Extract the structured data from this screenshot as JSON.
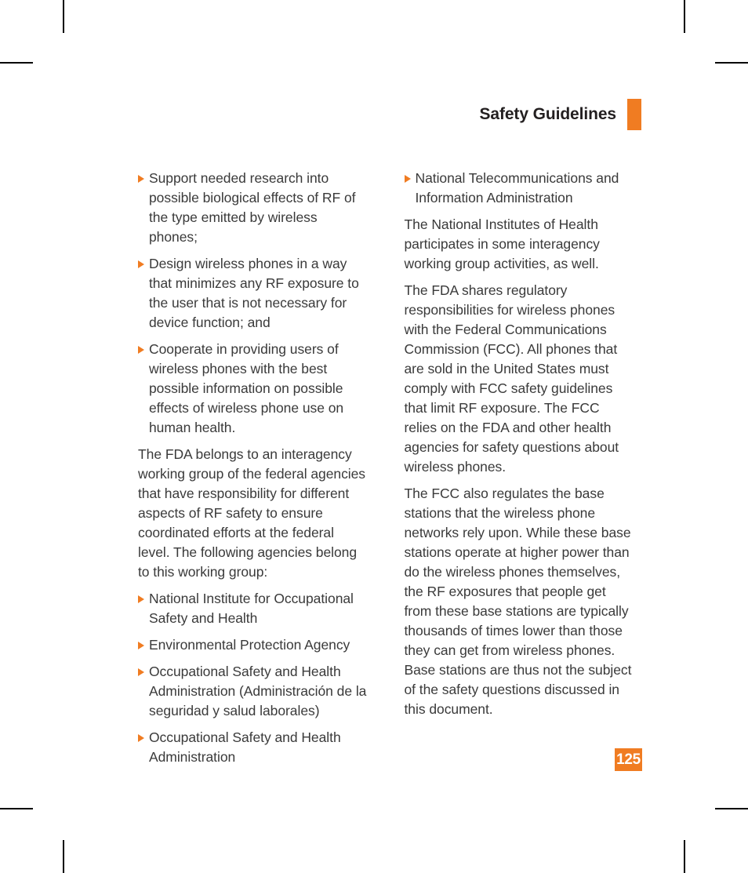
{
  "header": {
    "title": "Safety Guidelines",
    "accent_color": "#F07C22"
  },
  "page_number": "125",
  "body_text_color": "#3a3a3a",
  "columns": {
    "left": [
      {
        "type": "bullet",
        "text": "Support needed research into possible biological effects of RF of the type emitted by wireless phones;"
      },
      {
        "type": "bullet",
        "text": "Design wireless phones in a way that minimizes any RF exposure to the user that is not necessary for device function; and"
      },
      {
        "type": "bullet",
        "text": "Cooperate in providing users of wireless phones with the best possible information on possible effects of wireless phone use on human health."
      },
      {
        "type": "paragraph",
        "text": "The FDA belongs to an interagency working group of the federal agencies that have responsibility for different aspects of RF safety to ensure coordinated efforts at the federal level. The following agencies belong to this working group:"
      },
      {
        "type": "bullet",
        "text": "National Institute for Occupational Safety and Health"
      },
      {
        "type": "bullet",
        "text": "Environmental Protection Agency"
      },
      {
        "type": "bullet",
        "text": "Occupational Safety and Health Administration (Administración de la seguridad y salud laborales)"
      },
      {
        "type": "bullet",
        "text": "Occupational Safety and Health Administration"
      }
    ],
    "right": [
      {
        "type": "bullet",
        "text": "National Telecommunications and Information Administration"
      },
      {
        "type": "paragraph",
        "text": "The National Institutes of Health participates in some interagency working group activities, as well."
      },
      {
        "type": "paragraph",
        "text": "The FDA shares regulatory responsibilities for wireless phones with the Federal Communications Commission (FCC). All phones that are sold in the United States must comply with FCC safety guidelines that limit RF exposure. The FCC relies on the FDA and other health agencies for safety questions about wireless phones."
      },
      {
        "type": "paragraph",
        "text": "The FCC also regulates the base stations that the wireless phone networks rely upon. While these base stations operate at higher power than do the wireless phones themselves, the RF exposures that people get from these base stations are typically thousands of times lower than those they can get from wireless phones. Base stations are thus not the subject of the safety questions discussed in this document."
      }
    ]
  }
}
